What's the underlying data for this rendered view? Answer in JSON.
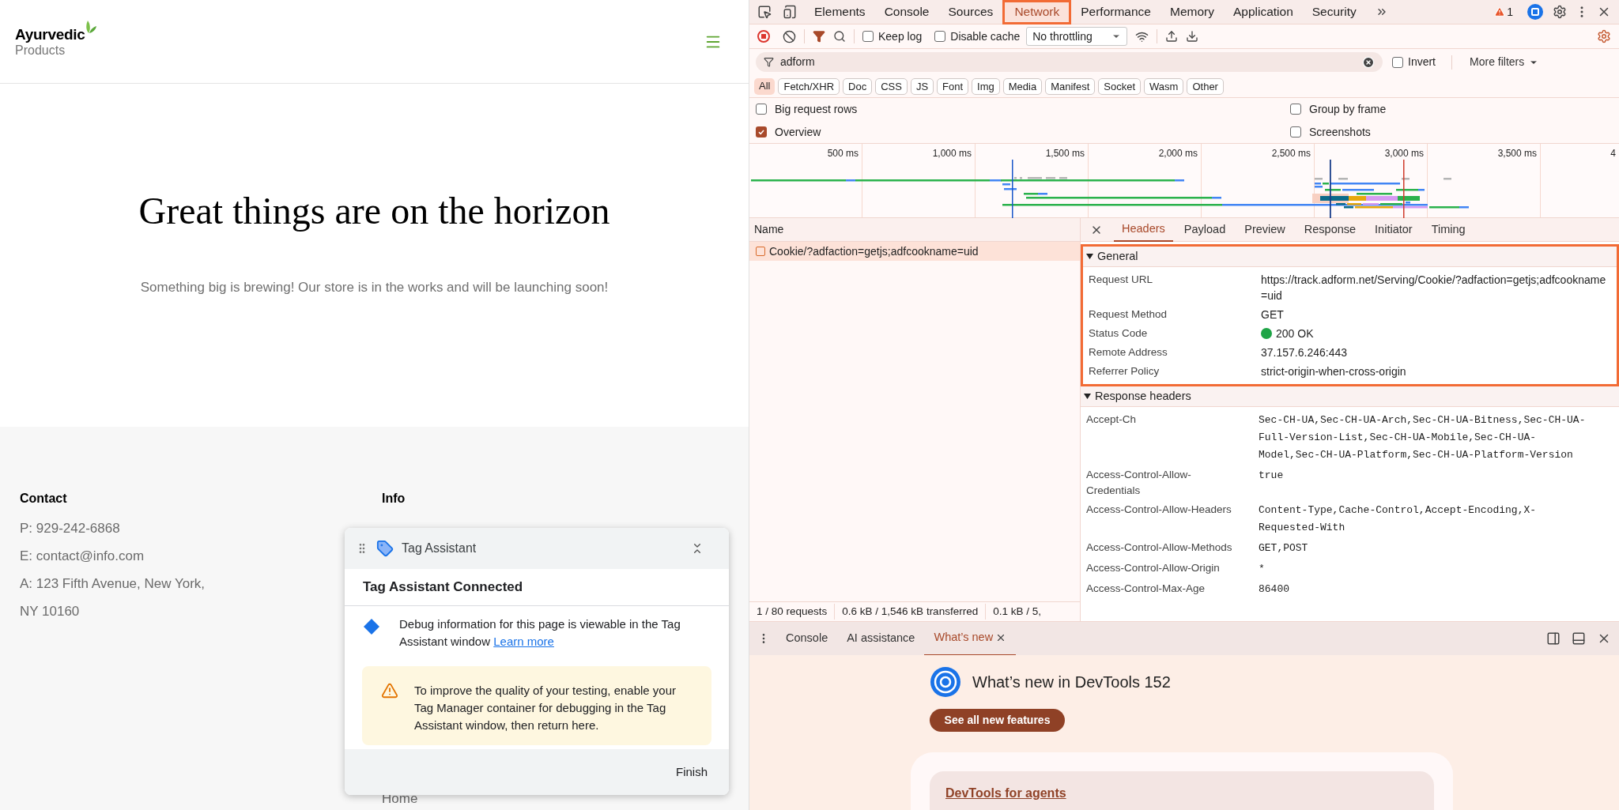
{
  "page": {
    "logo": {
      "name": "Ayurvedic",
      "subtitle": "Products"
    },
    "hero": {
      "title": "Great things are on the horizon",
      "subtitle": "Something big is brewing! Our store is in the works and will be launching soon!"
    },
    "footer": [
      {
        "heading": "Contact",
        "lines": [
          "P: 929-242-6868",
          "E: contact@info.com",
          "A: 123 Fifth Avenue, New York,",
          "NY 10160"
        ]
      },
      {
        "heading": "Info",
        "lines": [
          "Home"
        ]
      }
    ]
  },
  "tag_assistant": {
    "title": "Tag Assistant",
    "heading": "Tag Assistant Connected",
    "info": "Debug information for this page is viewable in the Tag Assistant window",
    "link": "Learn more",
    "warning": "To improve the quality of your testing, enable your Tag Manager container for debugging in the Tag Assistant window, then return here.",
    "button": "Finish"
  },
  "devtools": {
    "tabs": [
      {
        "label": "Elements",
        "selected": false,
        "highlighted": false
      },
      {
        "label": "Console",
        "selected": false,
        "highlighted": false
      },
      {
        "label": "Sources",
        "selected": false,
        "highlighted": false
      },
      {
        "label": "Network",
        "selected": true,
        "highlighted": true
      },
      {
        "label": "Performance",
        "selected": false,
        "highlighted": false
      },
      {
        "label": "Memory",
        "selected": false,
        "highlighted": false
      },
      {
        "label": "Application",
        "selected": false,
        "highlighted": false
      },
      {
        "label": "Security",
        "selected": false,
        "highlighted": false
      }
    ],
    "warnings": "1",
    "toolbar": {
      "recording": true,
      "checks": [
        {
          "label": "Keep log",
          "checked": false
        },
        {
          "label": "Disable cache",
          "checked": false
        }
      ],
      "throttling": "No throttling"
    },
    "filter": {
      "value": "adform",
      "invert": {
        "label": "Invert",
        "checked": false
      },
      "more_filters": "More filters"
    },
    "type_filters": [
      {
        "label": "All",
        "selected": true
      },
      {
        "label": "Fetch/XHR",
        "selected": false
      },
      {
        "label": "Doc",
        "selected": false
      },
      {
        "label": "CSS",
        "selected": false
      },
      {
        "label": "JS",
        "selected": false
      },
      {
        "label": "Font",
        "selected": false
      },
      {
        "label": "Img",
        "selected": false
      },
      {
        "label": "Media",
        "selected": false
      },
      {
        "label": "Manifest",
        "selected": false
      },
      {
        "label": "Socket",
        "selected": false
      },
      {
        "label": "Wasm",
        "selected": false
      },
      {
        "label": "Other",
        "selected": false
      }
    ],
    "options": [
      {
        "label": "Big request rows",
        "checked": false
      },
      {
        "label": "Group by frame",
        "checked": false
      },
      {
        "label": "Overview",
        "checked": true
      },
      {
        "label": "Screenshots",
        "checked": false
      }
    ],
    "timeline": {
      "ticks": [
        "500 ms",
        "1,000 ms",
        "1,500 ms",
        "2,000 ms",
        "2,500 ms",
        "3,000 ms",
        "3,500 ms",
        "4"
      ]
    },
    "requests": {
      "column": "Name",
      "rows": [
        {
          "name": "Cookie/?adfaction=getjs;adfcookname=uid",
          "selected": true
        }
      ]
    },
    "details": {
      "tabs": [
        {
          "label": "Headers",
          "selected": true
        },
        {
          "label": "Payload",
          "selected": false
        },
        {
          "label": "Preview",
          "selected": false
        },
        {
          "label": "Response",
          "selected": false
        },
        {
          "label": "Initiator",
          "selected": false
        },
        {
          "label": "Timing",
          "selected": false
        }
      ],
      "sections": [
        {
          "title": "General",
          "kind": "plain",
          "expanded": true,
          "highlighted": true,
          "rows": [
            {
              "name": "Request URL",
              "value": "https://track.adform.net/Serving/Cookie/?adfaction=getjs;adfcookname=uid"
            },
            {
              "name": "Request Method",
              "value": "GET"
            },
            {
              "name": "Status Code",
              "value": "200 OK",
              "color": "#1ea446"
            },
            {
              "name": "Remote Address",
              "value": "37.157.6.246:443"
            },
            {
              "name": "Referrer Policy",
              "value": "strict-origin-when-cross-origin"
            }
          ]
        },
        {
          "title": "Response headers",
          "kind": "mono",
          "expanded": true,
          "highlighted": false,
          "rows": [
            {
              "name": "Accept-Ch",
              "value": "Sec-CH-UA,Sec-CH-UA-Arch,Sec-CH-UA-Bitness,Sec-CH-UA-Full-Version-List,Sec-CH-UA-Mobile,Sec-CH-UA-Model,Sec-CH-UA-Platform,Sec-CH-UA-Platform-Version"
            },
            {
              "name": "Access-Control-Allow-Credentials",
              "value": "true"
            },
            {
              "name": "Access-Control-Allow-Headers",
              "value": "Content-Type,Cache-Control,Accept-Encoding,X-Requested-With"
            },
            {
              "name": "Access-Control-Allow-Methods",
              "value": "GET,POST"
            },
            {
              "name": "Access-Control-Allow-Origin",
              "value": "*"
            },
            {
              "name": "Access-Control-Max-Age",
              "value": "86400"
            }
          ]
        }
      ]
    },
    "status_bar": [
      "1 / 80 requests",
      "0.6 kB / 1,546 kB transferred",
      "0.1 kB / 5,"
    ],
    "drawer": {
      "tabs": [
        {
          "label": "Console",
          "selected": false,
          "closable": false
        },
        {
          "label": "AI assistance",
          "selected": false,
          "closable": false
        },
        {
          "label": "What’s new",
          "selected": true,
          "closable": true
        }
      ],
      "title": "What’s new in DevTools 152",
      "button": "See all new features",
      "card_link": "DevTools for agents"
    }
  }
}
